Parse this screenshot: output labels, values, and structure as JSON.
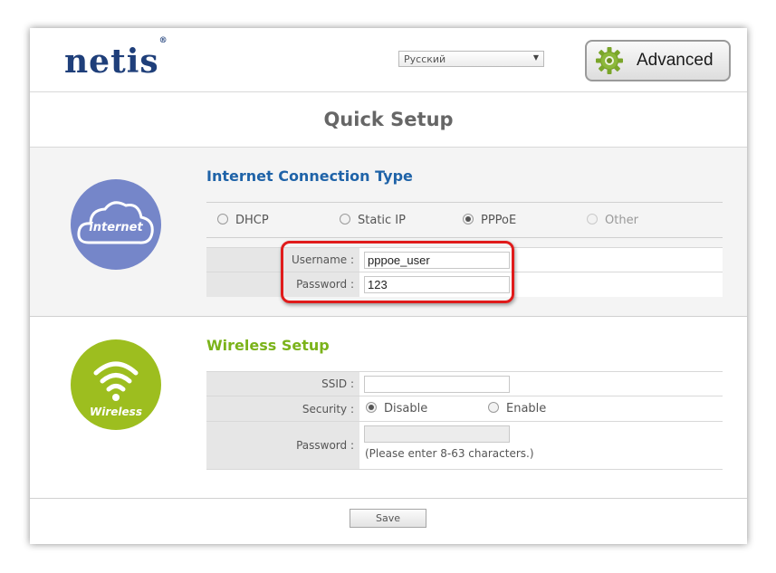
{
  "header": {
    "logo_text": "netis",
    "logo_mark": "®",
    "language_selected": "Русский",
    "advanced_label": "Advanced"
  },
  "page_title": "Quick Setup",
  "internet": {
    "icon_label": "internet",
    "title": "Internet Connection Type",
    "options": [
      "DHCP",
      "Static IP",
      "PPPoE",
      "Other"
    ],
    "selected": "PPPoE",
    "username_label": "Username :",
    "username_value": "pppoe_user",
    "password_label": "Password :",
    "password_value": "123"
  },
  "wireless": {
    "icon_label": "Wireless",
    "title": "Wireless Setup",
    "ssid_label": "SSID :",
    "ssid_value": "",
    "security_label": "Security :",
    "security_options": [
      "Disable",
      "Enable"
    ],
    "security_selected": "Disable",
    "password_label": "Password :",
    "password_hint": "(Please enter 8-63 characters.)"
  },
  "footer": {
    "save_label": "Save"
  },
  "colors": {
    "brand_blue": "#1f3f7a",
    "section_blue": "#1f63a8",
    "section_green": "#7bb31a",
    "internet_circle": "#7586c9",
    "wireless_circle": "#9dbe1f",
    "highlight_red": "#e01b1b"
  },
  "icons": [
    "gear-icon",
    "cloud-icon",
    "wifi-icon",
    "dropdown-arrow-icon"
  ]
}
